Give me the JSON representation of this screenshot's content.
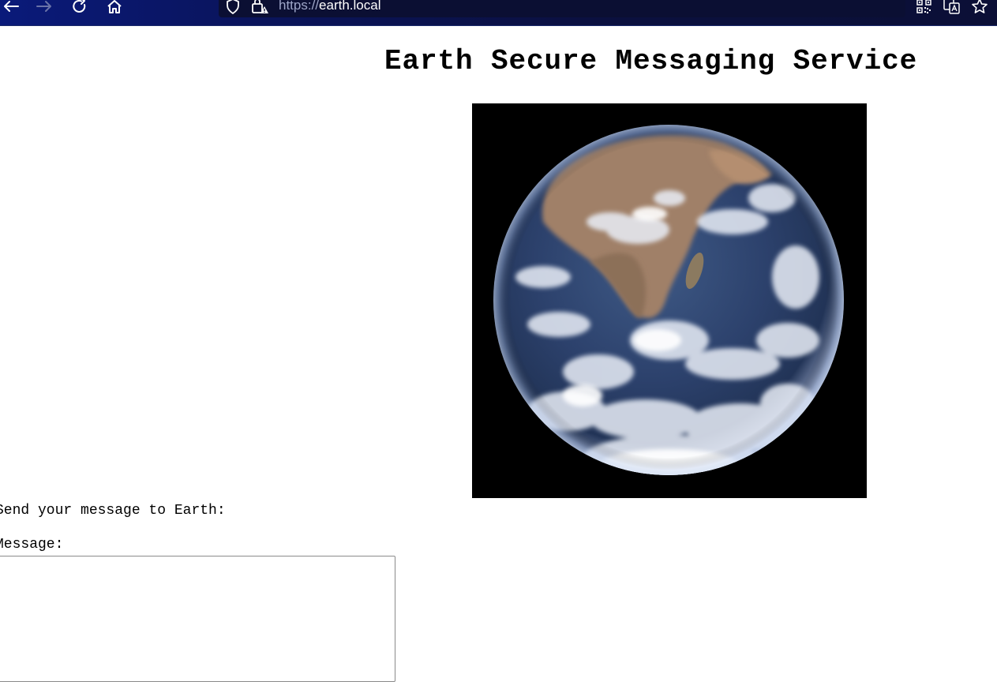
{
  "browser": {
    "url_scheme": "https://",
    "url_host": "earth.local",
    "icons": {
      "back": "arrow-left-icon",
      "forward": "arrow-right-icon",
      "reload": "reload-icon",
      "home": "home-icon",
      "tracking": "shield-icon",
      "lock": "lock-warning-icon",
      "qr": "qr-code-icon",
      "translate": "translate-icon",
      "bookmark": "star-icon"
    },
    "colors": {
      "toolbar_start": "#0a1a7a",
      "toolbar_end": "#0b0f36",
      "urlbar": "#0b0f33"
    }
  },
  "page": {
    "title": "Earth Secure Messaging Service",
    "image_alt": "Earth",
    "form": {
      "heading": "Send your message to Earth:",
      "message_label": "Message:",
      "message_value": ""
    }
  }
}
